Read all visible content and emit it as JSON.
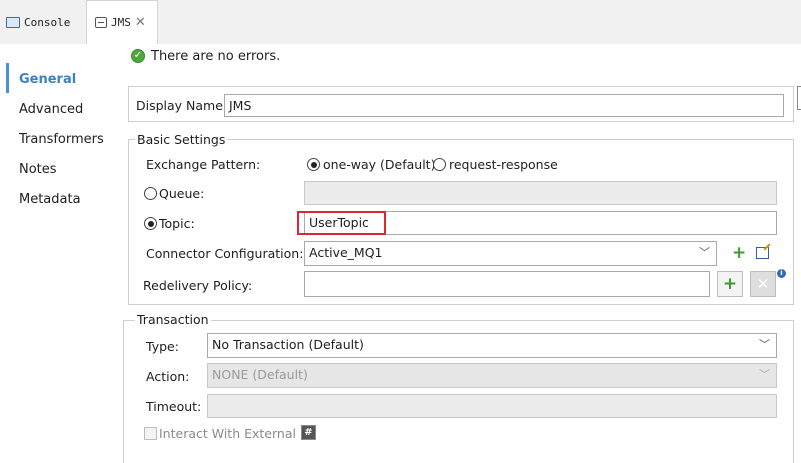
{
  "tabs": [
    {
      "label": "Console",
      "icon": "console-icon"
    },
    {
      "label": "JMS",
      "icon": "jms-icon",
      "close": "✕"
    }
  ],
  "nav": {
    "items": [
      "General",
      "Advanced",
      "Transformers",
      "Notes",
      "Metadata"
    ],
    "active": "General"
  },
  "status": {
    "icon": "✓",
    "text": "There are no errors."
  },
  "display_name": {
    "label": "Display Name:",
    "value": "JMS"
  },
  "basic": {
    "title": "Basic Settings",
    "exchange_label": "Exchange Pattern:",
    "exchange_options": [
      "one-way (Default)",
      "request-response"
    ],
    "exchange_selected": "one-way (Default)",
    "queue_label": "Queue:",
    "queue_value": "",
    "topic_label": "Topic:",
    "topic_value": "UserTopic",
    "topic_selected": true,
    "connector_label": "Connector Configuration:",
    "connector_value": "Active_MQ1",
    "redelivery_label": "Redelivery Policy:",
    "redelivery_value": "",
    "add_symbol": "+",
    "delete_symbol": "✕",
    "info_symbol": "i"
  },
  "transaction": {
    "title": "Transaction",
    "type_label": "Type:",
    "type_value": "No Transaction (Default)",
    "action_label": "Action:",
    "action_value": "NONE (Default)",
    "timeout_label": "Timeout:",
    "timeout_value": "",
    "interact_label": "Interact With External",
    "hash_symbol": "#"
  },
  "colors": {
    "accent": "#3b82c4",
    "highlight": "#d9282f",
    "ok": "#4fa83d"
  }
}
